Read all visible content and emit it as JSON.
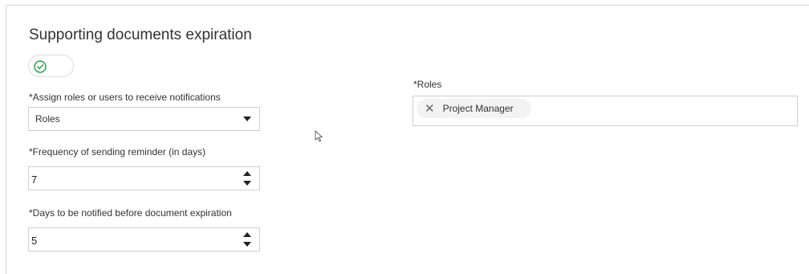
{
  "section": {
    "title": "Supporting documents expiration",
    "toggle_enabled": true
  },
  "notify": {
    "label": "*Assign roles or users to receive notifications",
    "selected": "Roles"
  },
  "frequency": {
    "label": "*Frequency of sending reminder (in days)",
    "value": "7"
  },
  "days_before": {
    "label": "*Days to be notified before document expiration",
    "value": "5"
  },
  "roles": {
    "label": "*Roles",
    "chips": [
      {
        "label": "Project Manager"
      }
    ]
  },
  "colors": {
    "toggle_check": "#2e9e4f",
    "border": "#cfcfcf",
    "chip_bg": "#f3f3f3"
  },
  "icons": {
    "toggle": "check-circle-icon",
    "dropdown": "caret-down-icon",
    "chip_remove": "close-icon",
    "pointer": "mouse-cursor-icon"
  }
}
